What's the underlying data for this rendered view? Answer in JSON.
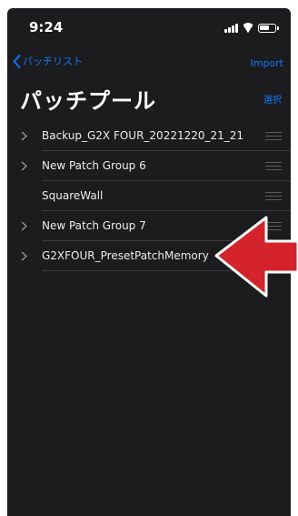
{
  "status_bar": {
    "time": "9:24"
  },
  "nav": {
    "back_label": "パッチリスト",
    "import_label": "Import"
  },
  "header": {
    "title": "パッチプール",
    "select_label": "選択"
  },
  "list": {
    "items": [
      {
        "label": "Backup_G2X FOUR_20221220_21_21",
        "has_chevron": true
      },
      {
        "label": "New Patch Group 6",
        "has_chevron": true
      },
      {
        "label": "SquareWall",
        "has_chevron": false
      },
      {
        "label": "New Patch Group 7",
        "has_chevron": true
      },
      {
        "label": "G2XFOUR_PresetPatchMemory",
        "has_chevron": true
      }
    ]
  },
  "colors": {
    "accent": "#0a7aff",
    "background": "#1c1c1e",
    "arrow": "#d4232b"
  },
  "icons": [
    "chevron-left-icon",
    "chevron-right-icon",
    "reorder-handle-icon",
    "signal-icon",
    "wifi-icon",
    "battery-icon",
    "red-arrow-icon"
  ]
}
